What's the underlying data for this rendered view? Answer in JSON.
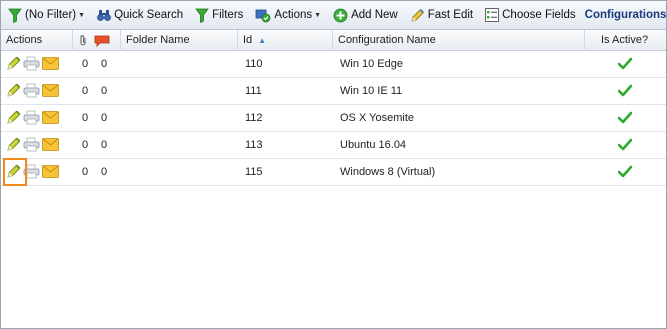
{
  "toolbar": {
    "filter_label": "(No Filter)",
    "quick_search_label": "Quick Search",
    "filters_label": "Filters",
    "actions_label": "Actions",
    "add_new_label": "Add New",
    "fast_edit_label": "Fast Edit",
    "choose_fields_label": "Choose Fields",
    "title": "Configurations"
  },
  "grid": {
    "columns": {
      "actions": "Actions",
      "folder_name": "Folder Name",
      "id": "Id",
      "configuration_name": "Configuration Name",
      "is_active": "Is Active?"
    },
    "rows": [
      {
        "attachments": "0",
        "comments": "0",
        "folder": "",
        "id": "110",
        "name": "Win 10 Edge",
        "active": true
      },
      {
        "attachments": "0",
        "comments": "0",
        "folder": "",
        "id": "111",
        "name": "Win 10 IE 11",
        "active": true
      },
      {
        "attachments": "0",
        "comments": "0",
        "folder": "",
        "id": "112",
        "name": "OS X Yosemite",
        "active": true
      },
      {
        "attachments": "0",
        "comments": "0",
        "folder": "",
        "id": "113",
        "name": "Ubuntu 16.04",
        "active": true
      },
      {
        "attachments": "0",
        "comments": "0",
        "folder": "",
        "id": "115",
        "name": "Windows 8 (Virtual)",
        "active": true
      }
    ]
  },
  "colors": {
    "highlight": "#f08a1c",
    "active_check": "#2eaa2e",
    "title": "#1a3a7a"
  }
}
